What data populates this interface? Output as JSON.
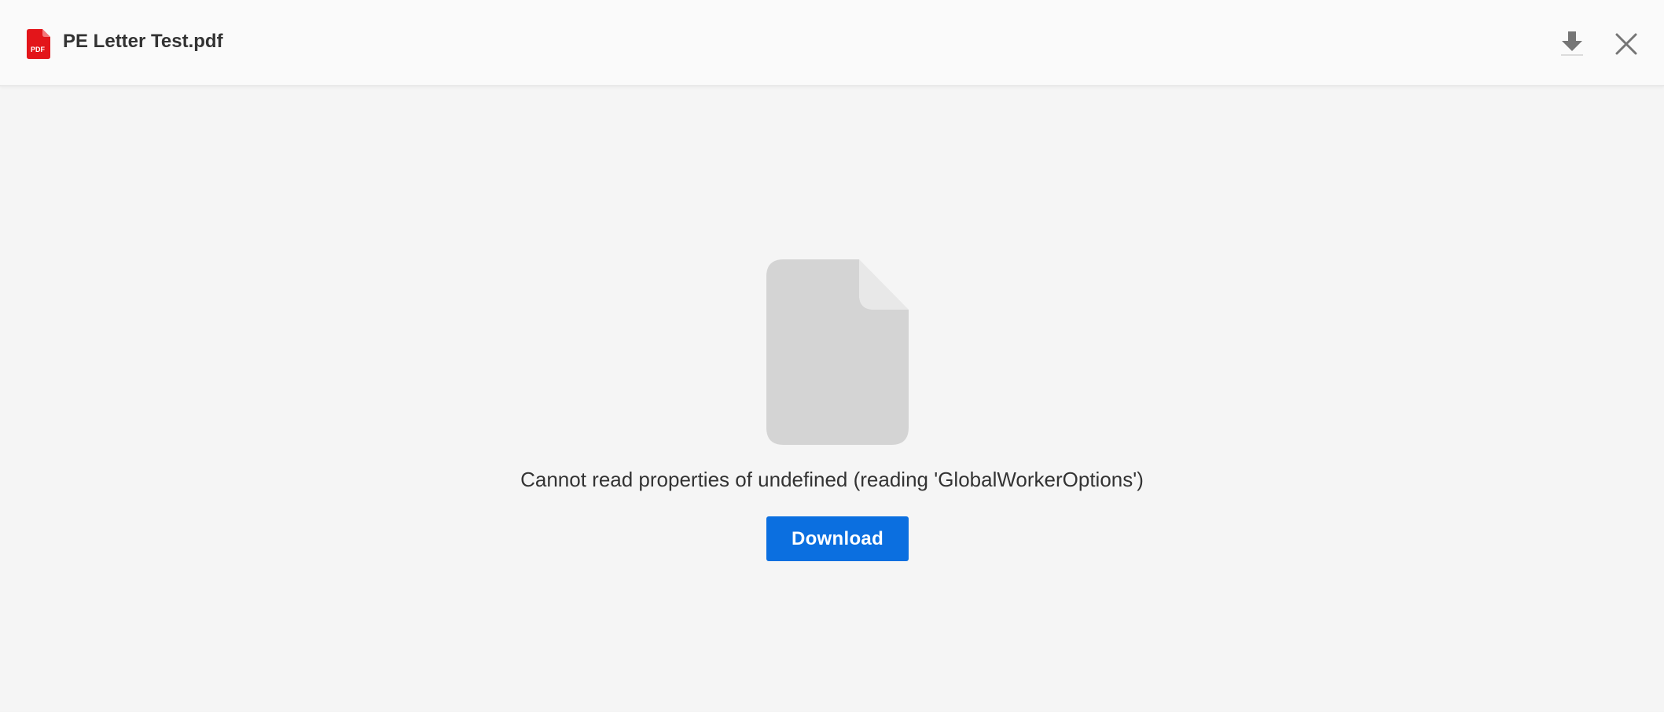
{
  "header": {
    "file_name": "PE Letter Test.pdf",
    "file_icon": "pdf-file-icon",
    "file_icon_label": "PDF",
    "actions": {
      "download_icon": "download-icon",
      "close_icon": "close-icon"
    }
  },
  "main": {
    "placeholder_icon": "document-placeholder-icon",
    "error_message": "Cannot read properties of undefined (reading 'GlobalWorkerOptions')",
    "download_label": "Download"
  },
  "colors": {
    "background": "#f5f5f5",
    "header_background": "#fafafa",
    "accent": "#0b6fe0",
    "pdf_red": "#e3151a",
    "placeholder_gray": "#d4d4d4"
  }
}
